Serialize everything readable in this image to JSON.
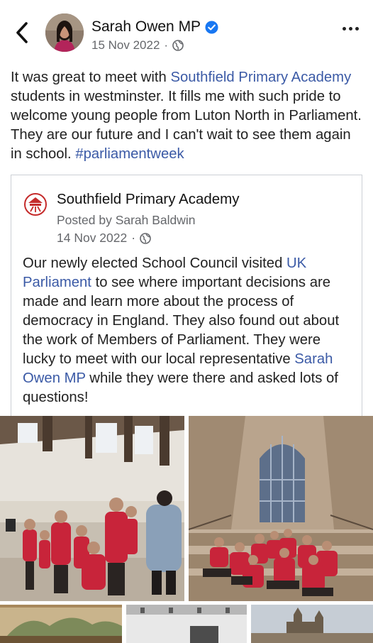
{
  "header": {
    "author": "Sarah Owen MP",
    "date": "15 Nov 2022",
    "separator": "·",
    "privacy_icon": "globe-icon",
    "verified_icon": "verified-badge-icon",
    "back_icon": "chevron-left-icon",
    "more_icon": "more-horizontal-icon"
  },
  "post": {
    "t1": "It was great to meet with ",
    "link1": "Southfield Primary Academy",
    "t2": " students in westminster. It fills me with such pride to welcome young people from Luton North in Parliament. They are our future and I can't wait to see them again in school. ",
    "hashtag": "#parliamentweek"
  },
  "shared": {
    "title": "Southfield Primary Academy",
    "posted_by": "Posted by Sarah Baldwin",
    "date": "14 Nov 2022",
    "separator": "·",
    "t1": "Our newly elected School Council visited ",
    "link1": "UK Parliament",
    "t2": " to see where important decisions are made and learn more about the process of democracy in England. They also found out about the work of Members of Parliament. They were lucky to meet with our local representative ",
    "link2": "Sarah Owen MP",
    "t3": " while they were there and asked lots of questions!"
  },
  "colors": {
    "link": "#3b5aa6",
    "verified": "#1877f2",
    "meta": "#65676b"
  }
}
